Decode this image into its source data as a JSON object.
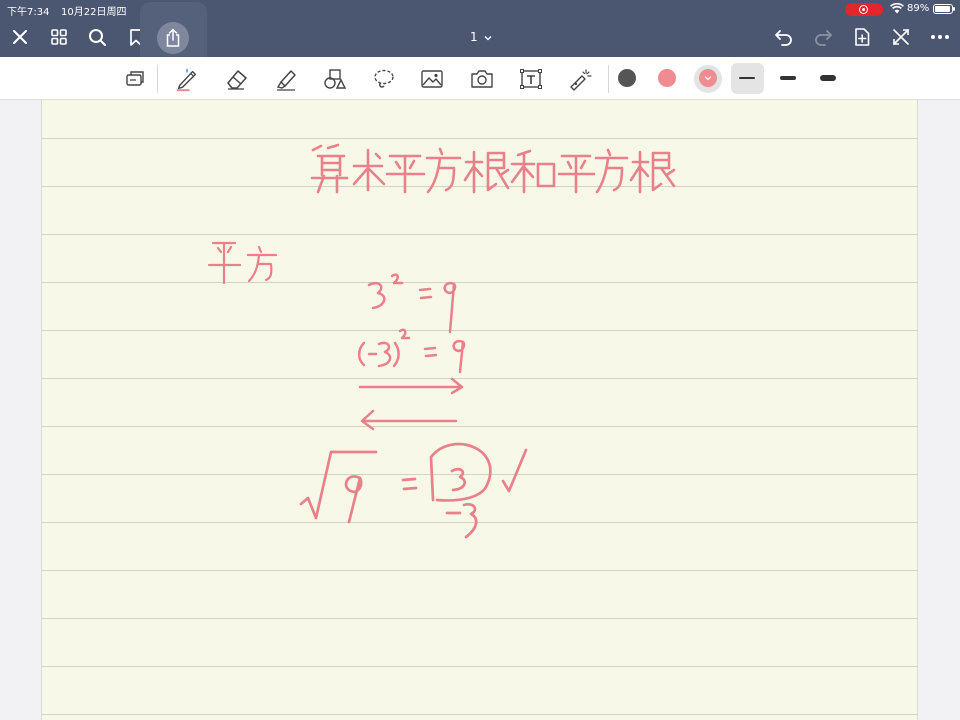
{
  "status_bar": {
    "time": "下午7:34",
    "date": "10月22日周四",
    "battery_percent": "89%",
    "icons": [
      "screen-record-icon",
      "wifi-icon",
      "battery-icon"
    ]
  },
  "nav_bar": {
    "page_indicator": "1",
    "left_buttons": [
      "close-icon",
      "grid-view-icon",
      "search-icon",
      "bookmark-icon",
      "share-icon"
    ],
    "right_buttons": [
      "undo-icon",
      "redo-icon",
      "add-page-icon",
      "collapse-toolbar-icon",
      "more-icon"
    ]
  },
  "toolbar": {
    "tools": [
      "shape-recognition-icon",
      "pen-icon",
      "eraser-icon",
      "highlighter-icon",
      "shapes-icon",
      "lasso-icon",
      "image-icon",
      "camera-icon",
      "text-box-icon",
      "laser-pointer-icon"
    ],
    "active_tool": "pen",
    "colors": [
      "#555555",
      "#ef8c92",
      "#ef8c92"
    ],
    "selected_color": "#ef8c92",
    "stroke_widths": [
      "thin",
      "medium",
      "thick"
    ],
    "selected_stroke": "thin"
  },
  "note": {
    "ink_color": "#ea808a",
    "paper_color": "#f7f8e8",
    "handwriting": {
      "title": "算术平方根和平方根",
      "side_label": "平方",
      "line1": "3² = 9",
      "line2": "(-3)² = 9",
      "line3": "√9 = 3 √",
      "line3_below": "-3"
    }
  }
}
